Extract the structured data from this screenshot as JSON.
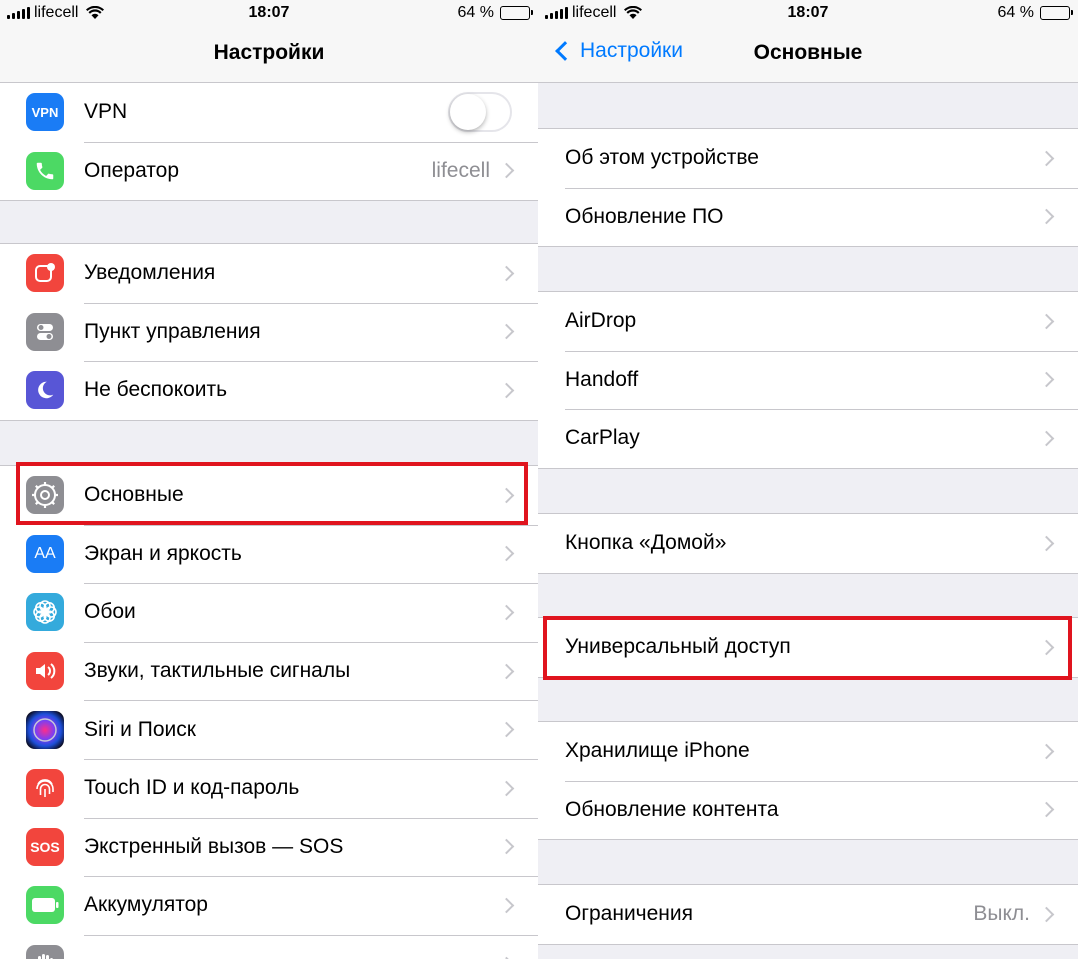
{
  "left": {
    "status": {
      "carrier": "lifecell",
      "time": "18:07",
      "battery": "64 %",
      "battery_level": 0.64
    },
    "nav": {
      "title": "Настройки"
    },
    "groups": [
      {
        "rows": [
          {
            "icon": "vpn-icon",
            "icon_text": "VPN",
            "color": "#1a7cf5",
            "label": "VPN",
            "toggle": false
          },
          {
            "icon": "phone-icon",
            "color": "#4cd964",
            "label": "Оператор",
            "value": "lifecell"
          }
        ]
      },
      {
        "rows": [
          {
            "icon": "notifications-icon",
            "color": "#f2453d",
            "label": "Уведомления"
          },
          {
            "icon": "control-center-icon",
            "color": "#8e8e93",
            "label": "Пункт управления"
          },
          {
            "icon": "moon-icon",
            "color": "#5856d6",
            "label": "Не беспокоить"
          }
        ]
      },
      {
        "rows": [
          {
            "icon": "gear-icon",
            "color": "#8e8e93",
            "label": "Основные"
          },
          {
            "icon": "display-brightness-icon",
            "icon_text": "AA",
            "color": "#1a7cf5",
            "label": "Экран и яркость"
          },
          {
            "icon": "wallpaper-flower-icon",
            "color": "#34aadc",
            "label": "Обои"
          },
          {
            "icon": "speaker-icon",
            "color": "#f2453d",
            "label": "Звуки, тактильные сигналы"
          },
          {
            "icon": "siri-icon",
            "color": "#1c1c3a",
            "label": "Siri и Поиск"
          },
          {
            "icon": "fingerprint-icon",
            "color": "#f2453d",
            "label": "Touch ID и код-пароль"
          },
          {
            "icon": "sos-icon",
            "icon_text": "SOS",
            "color": "#f2453d",
            "label": "Экстренный вызов — SOS"
          },
          {
            "icon": "battery-icon",
            "color": "#4cd964",
            "label": "Аккумулятор"
          },
          {
            "icon": "privacy-hand-icon",
            "color": "#8e8e93",
            "label": ""
          }
        ]
      }
    ]
  },
  "right": {
    "status": {
      "carrier": "lifecell",
      "time": "18:07",
      "battery": "64 %",
      "battery_level": 0.64
    },
    "nav": {
      "back": "Настройки",
      "title": "Основные"
    },
    "groups": [
      {
        "rows": [
          {
            "label": "Об этом устройстве"
          },
          {
            "label": "Обновление ПО"
          }
        ]
      },
      {
        "rows": [
          {
            "label": "AirDrop"
          },
          {
            "label": "Handoff"
          },
          {
            "label": "CarPlay"
          }
        ]
      },
      {
        "rows": [
          {
            "label": "Кнопка «Домой»"
          }
        ]
      },
      {
        "rows": [
          {
            "label": "Универсальный доступ"
          }
        ]
      },
      {
        "rows": [
          {
            "label": "Хранилище iPhone"
          },
          {
            "label": "Обновление контента"
          }
        ]
      },
      {
        "rows": [
          {
            "label": "Ограничения",
            "value": "Выкл."
          }
        ]
      }
    ]
  }
}
